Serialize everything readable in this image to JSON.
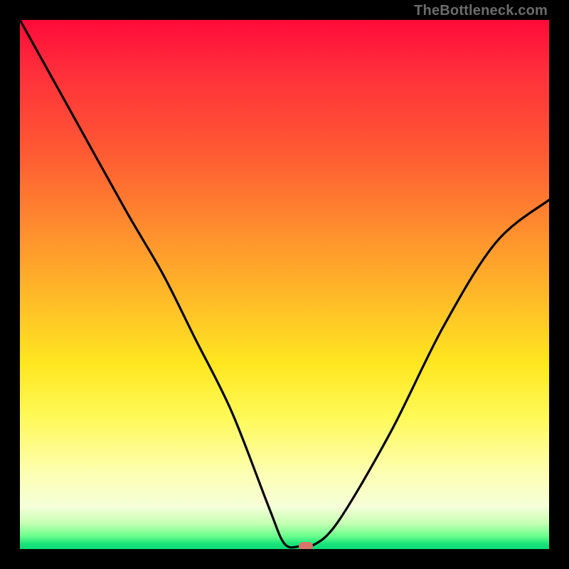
{
  "watermark": "TheBottleneck.com",
  "chart_data": {
    "type": "line",
    "title": "",
    "xlabel": "",
    "ylabel": "",
    "xlim": [
      0,
      100
    ],
    "ylim": [
      0,
      100
    ],
    "grid": false,
    "legend": false,
    "series": [
      {
        "name": "bottleneck-curve",
        "x": [
          0,
          10,
          20,
          27,
          33,
          40,
          47,
          50,
          53,
          55,
          60,
          70,
          80,
          90,
          100
        ],
        "y": [
          100,
          82,
          64,
          52,
          40,
          26,
          8,
          1,
          0.5,
          0.5,
          5,
          22,
          42,
          58,
          66
        ]
      }
    ],
    "annotations": [
      {
        "name": "min-marker",
        "x": 54,
        "y": 0.5,
        "style": "pill",
        "color": "#d9746a"
      }
    ],
    "background": {
      "type": "vertical-gradient",
      "stops": [
        {
          "pos": 0,
          "color": "#ff0a3a"
        },
        {
          "pos": 0.4,
          "color": "#ff8f2e"
        },
        {
          "pos": 0.65,
          "color": "#ffe720"
        },
        {
          "pos": 0.9,
          "color": "#f5ffd8"
        },
        {
          "pos": 1.0,
          "color": "#0fd877"
        }
      ]
    }
  }
}
